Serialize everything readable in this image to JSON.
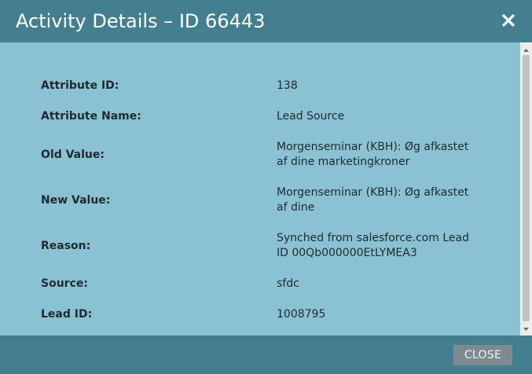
{
  "dialog": {
    "title": "Activity Details – ID 66443",
    "close_icon": "close-icon",
    "close_button_label": "CLOSE"
  },
  "details": [
    {
      "label": "Attribute ID:",
      "value": "138"
    },
    {
      "label": "Attribute Name:",
      "value": "Lead Source"
    },
    {
      "label": "Old Value:",
      "value": "Morgenseminar (KBH): Øg afkastet af dine marketingkroner"
    },
    {
      "label": "New Value:",
      "value": "Morgenseminar (KBH): Øg afkastet af dine"
    },
    {
      "label": "Reason:",
      "value": "Synched from salesforce.com Lead ID 00Qb000000EtLYMEA3"
    },
    {
      "label": "Source:",
      "value": "sfdc"
    },
    {
      "label": "Lead ID:",
      "value": "1008795"
    }
  ],
  "colors": {
    "header": "#447f90",
    "content": "#8ac2d3",
    "button": "#7d8a8f"
  }
}
